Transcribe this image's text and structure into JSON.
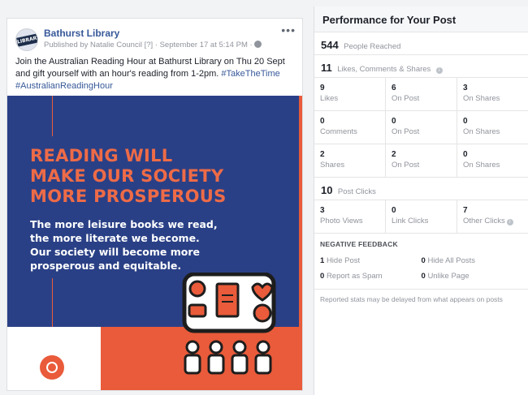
{
  "post": {
    "page_name": "Bathurst Library",
    "avatar_text": "LIBRARY",
    "published_by": "Published by Natalie Council",
    "help_marker": "[?]",
    "date": "September 17 at 5:14 PM",
    "separator": "·",
    "more_menu": "•••",
    "text": "Join the Australian Reading Hour at Bathurst Library on Thu 20 Sept and gift yourself with an hour's reading from 1-2pm.",
    "hashtag_1": "#TakeTheTime",
    "hashtag_2": "#AustralianReadingHour",
    "image": {
      "headline_1": "READING WILL",
      "headline_2": "MAKE OUR SOCIETY",
      "headline_3": "MORE PROSPEROUS",
      "sub_1": "The more leisure books we read,",
      "sub_2": "the more literate we become.",
      "sub_3": "Our society will become more",
      "sub_4": "prosperous and equitable.",
      "colors": {
        "navy": "#2a4086",
        "orange": "#e95b3a"
      }
    }
  },
  "performance": {
    "title": "Performance for Your Post",
    "reached": {
      "num": "544",
      "label": "People Reached"
    },
    "engagement": {
      "num": "11",
      "label": "Likes, Comments & Shares"
    },
    "likes_row": [
      {
        "n": "9",
        "l": "Likes"
      },
      {
        "n": "6",
        "l": "On Post"
      },
      {
        "n": "3",
        "l": "On Shares"
      }
    ],
    "comments_row": [
      {
        "n": "0",
        "l": "Comments"
      },
      {
        "n": "0",
        "l": "On Post"
      },
      {
        "n": "0",
        "l": "On Shares"
      }
    ],
    "shares_row": [
      {
        "n": "2",
        "l": "Shares"
      },
      {
        "n": "2",
        "l": "On Post"
      },
      {
        "n": "0",
        "l": "On Shares"
      }
    ],
    "clicks": {
      "num": "10",
      "label": "Post Clicks"
    },
    "clicks_row": [
      {
        "n": "3",
        "l": "Photo Views"
      },
      {
        "n": "0",
        "l": "Link Clicks"
      },
      {
        "n": "7",
        "l": "Other Clicks"
      }
    ],
    "negative": {
      "title": "NEGATIVE FEEDBACK",
      "hide_post": {
        "n": "1",
        "l": "Hide Post"
      },
      "hide_all": {
        "n": "0",
        "l": "Hide All Posts"
      },
      "spam": {
        "n": "0",
        "l": "Report as Spam"
      },
      "unlike": {
        "n": "0",
        "l": "Unlike Page"
      }
    },
    "note": "Reported stats may be delayed from what appears on posts"
  }
}
